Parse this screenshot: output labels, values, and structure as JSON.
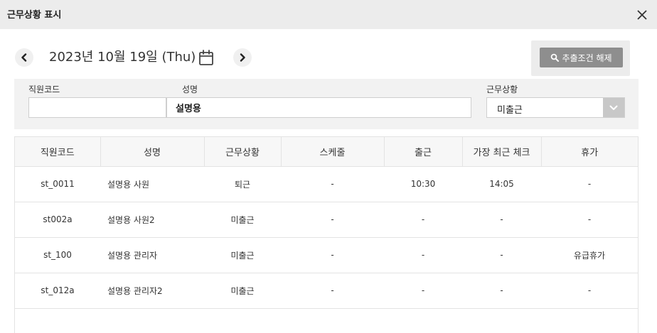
{
  "window": {
    "title": "근무상황 표시",
    "close_symbol": "✕"
  },
  "date_nav": {
    "prev_symbol": "‹",
    "next_symbol": "›",
    "date_text": "2023년 10월 19일 (Thu)"
  },
  "reset_button": {
    "label": "추출조건 해제"
  },
  "filters": {
    "employee_code": {
      "label": "직원코드",
      "value": ""
    },
    "name": {
      "label": "성명",
      "value": "설명용"
    },
    "status": {
      "label": "근무상황",
      "value": "미출근"
    }
  },
  "table": {
    "headers": [
      "직원코드",
      "성명",
      "근무상황",
      "스케줄",
      "출근",
      "가장 최근 체크",
      "휴가"
    ],
    "rows": [
      [
        "st_0011",
        "설명용 사원",
        "퇴근",
        "-",
        "10:30",
        "14:05",
        "-"
      ],
      [
        "st002a",
        "설명용 사원2",
        "미출근",
        "-",
        "-",
        "-",
        "-"
      ],
      [
        "st_100",
        "설명용 관리자",
        "미출근",
        "-",
        "-",
        "-",
        "유급휴가"
      ],
      [
        "st_012a",
        "설명용 관리자2",
        "미출근",
        "-",
        "-",
        "-",
        "-"
      ]
    ]
  },
  "colors": {
    "titlebar": "#ececec",
    "button_gray": "#8e8e8e",
    "panel": "#f2f2f2"
  }
}
